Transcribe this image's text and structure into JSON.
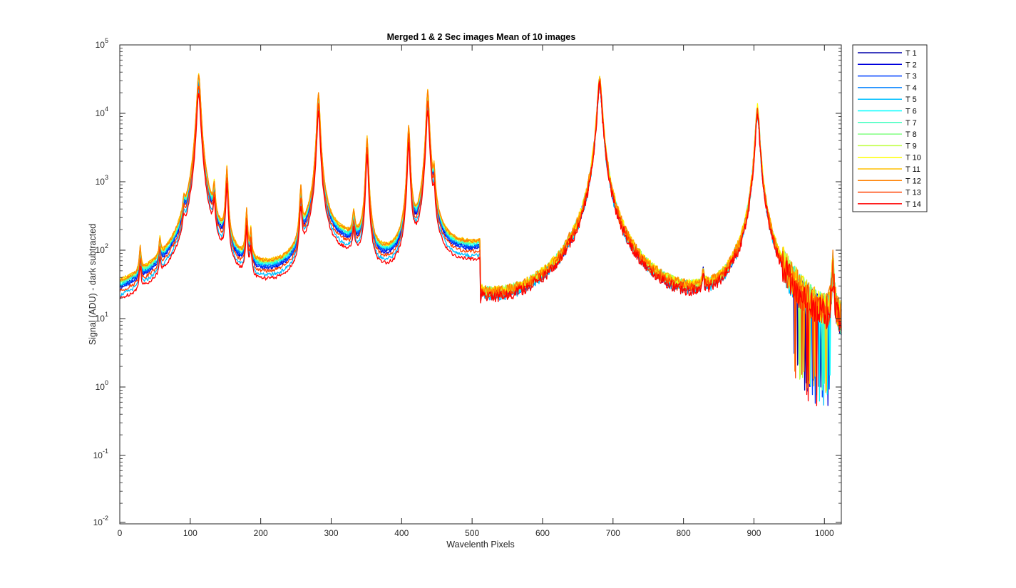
{
  "chart_data": {
    "type": "line",
    "title": "Merged 1 & 2 Sec images  Mean of 10 images",
    "xlabel": "Wavelenth Pixels",
    "ylabel": "Signal (ADU) - dark subtracted",
    "xlim": [
      0,
      1024
    ],
    "ylim": [
      0.01,
      100000
    ],
    "yscale": "log",
    "grid": false,
    "legend_position": "outside-top-right",
    "xticks": [
      "0",
      "100",
      "200",
      "300",
      "400",
      "500",
      "600",
      "700",
      "800",
      "900",
      "1000"
    ],
    "yticks": [
      {
        "base": "10",
        "exp": "-2"
      },
      {
        "base": "10",
        "exp": "-1"
      },
      {
        "base": "10",
        "exp": "0"
      },
      {
        "base": "10",
        "exp": "1"
      },
      {
        "base": "10",
        "exp": "2"
      },
      {
        "base": "10",
        "exp": "3"
      },
      {
        "base": "10",
        "exp": "4"
      },
      {
        "base": "10",
        "exp": "5"
      }
    ],
    "baseline": {
      "x": [
        0,
        25,
        40,
        55,
        70,
        85,
        100,
        125,
        145,
        170,
        200,
        230,
        250,
        265,
        290,
        320,
        340,
        360,
        380,
        400,
        420,
        440,
        460,
        480,
        500,
        511,
        512,
        520,
        540,
        560,
        580,
        600,
        620,
        650,
        680,
        700,
        720,
        750,
        780,
        800,
        830,
        860,
        890,
        905,
        920,
        940,
        960,
        980,
        1000,
        1024
      ],
      "y": [
        17,
        19,
        21,
        22,
        23,
        25,
        29,
        33,
        31,
        28,
        29,
        33,
        40,
        110,
        140,
        120,
        100,
        58,
        54,
        51,
        53,
        60,
        78,
        85,
        93,
        100,
        3.2,
        3.0,
        3.4,
        4.0,
        4.6,
        5.0,
        5.4,
        7.5,
        12,
        9,
        7.5,
        6.8,
        6.4,
        6.3,
        6.5,
        6.6,
        7.0,
        8,
        6,
        4,
        2.6,
        1.8,
        1.5,
        1.4
      ]
    },
    "peaks": [
      {
        "x": 29,
        "y": 55,
        "w": 1.2
      },
      {
        "x": 57,
        "y": 60,
        "w": 1.2
      },
      {
        "x": 91,
        "y": 200,
        "w": 1.5
      },
      {
        "x": 112,
        "y": 32000,
        "w": 2.2
      },
      {
        "x": 134,
        "y": 550,
        "w": 1.4
      },
      {
        "x": 152,
        "y": 1300,
        "w": 1.4
      },
      {
        "x": 180,
        "y": 270,
        "w": 1.3
      },
      {
        "x": 186,
        "y": 110,
        "w": 1.2
      },
      {
        "x": 257,
        "y": 580,
        "w": 1.5
      },
      {
        "x": 282,
        "y": 17000,
        "w": 1.8
      },
      {
        "x": 332,
        "y": 180,
        "w": 1.5
      },
      {
        "x": 351,
        "y": 3800,
        "w": 1.5
      },
      {
        "x": 410,
        "y": 5800,
        "w": 1.5
      },
      {
        "x": 437,
        "y": 18000,
        "w": 1.8
      },
      {
        "x": 446,
        "y": 900,
        "w": 1.2
      },
      {
        "x": 638,
        "y": 13,
        "w": 1.3
      },
      {
        "x": 681,
        "y": 30000,
        "w": 2.8
      },
      {
        "x": 828,
        "y": 18,
        "w": 1.3
      },
      {
        "x": 873,
        "y": 11,
        "w": 1.2
      },
      {
        "x": 905,
        "y": 11000,
        "w": 2.6
      },
      {
        "x": 1012,
        "y": 45,
        "w": 1.6
      }
    ],
    "series": [
      {
        "name": "T 1",
        "color": "#0000aa",
        "scale": 0.95
      },
      {
        "name": "T 2",
        "color": "#0000dd",
        "scale": 0.88
      },
      {
        "name": "T 3",
        "color": "#0040ff",
        "scale": 0.92
      },
      {
        "name": "T 4",
        "color": "#0080ff",
        "scale": 0.97
      },
      {
        "name": "T 5",
        "color": "#00bfff",
        "scale": 0.7
      },
      {
        "name": "T 6",
        "color": "#00ffff",
        "scale": 1.02
      },
      {
        "name": "T 7",
        "color": "#40ffbf",
        "scale": 1.06
      },
      {
        "name": "T 8",
        "color": "#80ff80",
        "scale": 1.1
      },
      {
        "name": "T 9",
        "color": "#bfff40",
        "scale": 1.13
      },
      {
        "name": "T 10",
        "color": "#ffff00",
        "scale": 1.15
      },
      {
        "name": "T 11",
        "color": "#ffbf00",
        "scale": 1.17
      },
      {
        "name": "T 12",
        "color": "#ff8000",
        "scale": 1.14
      },
      {
        "name": "T 13",
        "color": "#ff4000",
        "scale": 0.8
      },
      {
        "name": "T 14",
        "color": "#ff0000",
        "scale": 0.62
      }
    ],
    "colors": {
      "axis": "#262626",
      "background": "#ffffff"
    }
  }
}
